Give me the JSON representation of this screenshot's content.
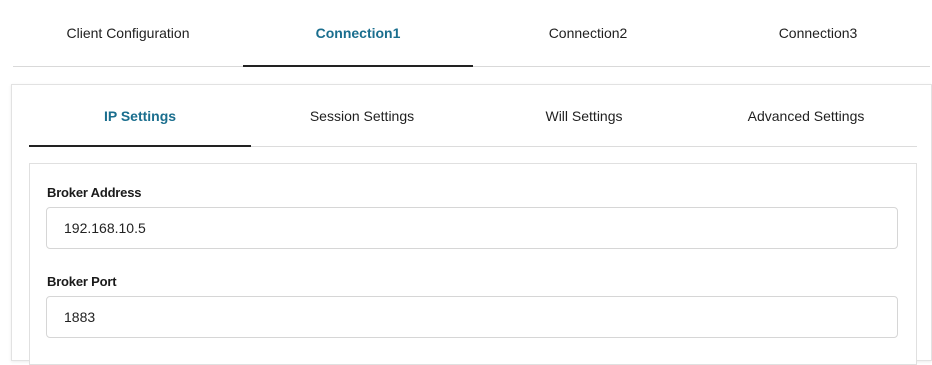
{
  "top_tabs": [
    {
      "label": "Client Configuration",
      "active": false
    },
    {
      "label": "Connection1",
      "active": true
    },
    {
      "label": "Connection2",
      "active": false
    },
    {
      "label": "Connection3",
      "active": false
    }
  ],
  "sub_tabs": [
    {
      "label": "IP Settings",
      "active": true
    },
    {
      "label": "Session Settings",
      "active": false
    },
    {
      "label": "Will Settings",
      "active": false
    },
    {
      "label": "Advanced Settings",
      "active": false
    }
  ],
  "form": {
    "broker_address": {
      "label": "Broker Address",
      "value": "192.168.10.5"
    },
    "broker_port": {
      "label": "Broker Port",
      "value": "1883"
    }
  },
  "colors": {
    "active_tab_text": "#1a6e8e",
    "active_underline": "#222222"
  }
}
